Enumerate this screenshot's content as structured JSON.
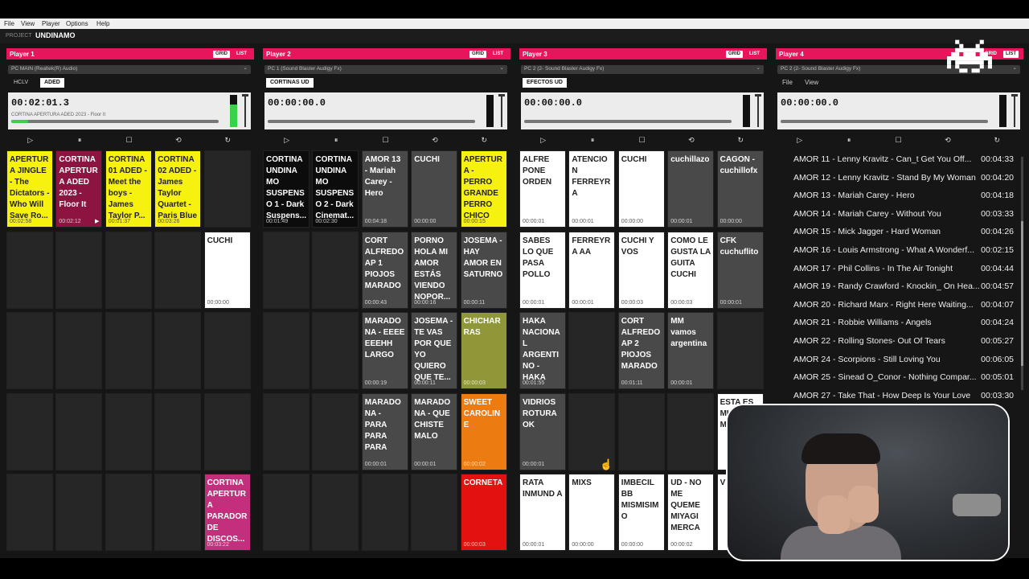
{
  "menu": {
    "file": "File",
    "view": "View",
    "player": "Player",
    "options": "Options",
    "help": "Help"
  },
  "project": {
    "label": "PROJECT",
    "name": "UNDINAMO"
  },
  "colors": {
    "accent": "#e6155c",
    "meter": "#38d14a"
  },
  "players": [
    {
      "name": "Player 1",
      "grid": "GRID",
      "list": "LIST",
      "device": "PC MAIN (Realtek(R) Audio)",
      "tabs": [
        "HCLV",
        "ADED"
      ],
      "active_tab": "ADED",
      "time": "00:02:01.3",
      "track": "CORTINA APERTURA ADED 2023 - Floor It",
      "progress": 0.08,
      "level": 0.7
    },
    {
      "name": "Player 2",
      "grid": "GRID",
      "list": "LIST",
      "device": "PC 1 (Sound Blaster Audigy Fx)",
      "tabs": [
        "CORTINAS UD"
      ],
      "active_tab": "CORTINAS UD",
      "time": "00:00:00.0",
      "track": "",
      "progress": 0,
      "level": 0
    },
    {
      "name": "Player 3",
      "grid": "GRID",
      "list": "LIST",
      "device": "PC 2 (2- Sound Blaster Audigy Fx)",
      "tabs": [
        "EFECTOS UD"
      ],
      "active_tab": "EFECTOS UD",
      "time": "00:00:00.0",
      "track": "",
      "progress": 0,
      "level": 0
    },
    {
      "name": "Player 4",
      "grid": "GRID",
      "list": "LIST",
      "device": "PC 2 (2- Sound Blaster Audigy Fx)",
      "tabs": [],
      "menu": [
        "File",
        "View"
      ],
      "time": "00:00:00.0",
      "track": "",
      "progress": 0,
      "level": 0
    }
  ],
  "controls": {
    "play": "play-icon",
    "pause": "pause-icon",
    "stop": "stop-icon",
    "loop": "loop-icon",
    "repeat": "repeat-icon"
  },
  "p1_cells": [
    {
      "title": "APERTUR A JINGLE - The Dictators - Who Will Save Ro...",
      "dur": "00:02:58",
      "color": "yellow"
    },
    {
      "title": "CORTINA APERTUR A ADED 2023 - Floor It",
      "dur": "00:02:12",
      "color": "maroon",
      "playing": true
    },
    {
      "title": "CORTINA 01 ADED - Meet the boys - James Taylor P...",
      "dur": "00:01:37",
      "color": "yellow"
    },
    {
      "title": "CORTINA 02 ADED - James Taylor Quartet - Paris Blue",
      "dur": "00:03:26",
      "color": "yellow"
    },
    {
      "title": "",
      "dur": "",
      "color": "empty"
    },
    {
      "title": "",
      "dur": "",
      "color": "empty"
    },
    {
      "title": "",
      "dur": "",
      "color": "empty"
    },
    {
      "title": "",
      "dur": "",
      "color": "empty"
    },
    {
      "title": "",
      "dur": "",
      "color": "empty"
    },
    {
      "title": "CUCHI",
      "dur": "00:00:00",
      "color": "white"
    },
    {
      "title": "",
      "dur": "",
      "color": "empty"
    },
    {
      "title": "",
      "dur": "",
      "color": "empty"
    },
    {
      "title": "",
      "dur": "",
      "color": "empty"
    },
    {
      "title": "",
      "dur": "",
      "color": "empty"
    },
    {
      "title": "",
      "dur": "",
      "color": "empty"
    },
    {
      "title": "",
      "dur": "",
      "color": "empty"
    },
    {
      "title": "",
      "dur": "",
      "color": "empty"
    },
    {
      "title": "",
      "dur": "",
      "color": "empty"
    },
    {
      "title": "",
      "dur": "",
      "color": "empty"
    },
    {
      "title": "",
      "dur": "",
      "color": "empty"
    },
    {
      "title": "",
      "dur": "",
      "color": "empty"
    },
    {
      "title": "",
      "dur": "",
      "color": "empty"
    },
    {
      "title": "",
      "dur": "",
      "color": "empty"
    },
    {
      "title": "",
      "dur": "",
      "color": "empty"
    },
    {
      "title": "CORTINA APERTUR A PARADOR DE DISCOS...",
      "dur": "00:03:22",
      "color": "pink"
    }
  ],
  "p2_cells": [
    {
      "title": "CORTINA UNDINA MO SUSPENS O 1 - Dark Suspens...",
      "dur": "00:01:49",
      "color": "black"
    },
    {
      "title": "CORTINA UNDINA MO SUSPENS O 2 - Dark Cinemat...",
      "dur": "00:02:30",
      "color": "black"
    },
    {
      "title": "AMOR 13 - Mariah Carey - Hero",
      "dur": "00:04:18",
      "color": "dk"
    },
    {
      "title": "CUCHI",
      "dur": "00:00:00",
      "color": "dk"
    },
    {
      "title": "APERTUR A - PERRO GRANDE PERRO CHICO",
      "dur": "00:00:15",
      "color": "yellow"
    },
    {
      "title": "",
      "dur": "",
      "color": "empty"
    },
    {
      "title": "",
      "dur": "",
      "color": "empty"
    },
    {
      "title": "CORT ALFREDO AP 1 PIOJOS MARADO",
      "dur": "00:00:43",
      "color": "dk"
    },
    {
      "title": "PORNO HOLA MI AMOR ESTÁS VIENDO NOPOR...",
      "dur": "00:00:16",
      "color": "dk"
    },
    {
      "title": "JOSEMA - HAY AMOR EN SATURNO",
      "dur": "00:00:11",
      "color": "dk"
    },
    {
      "title": "",
      "dur": "",
      "color": "empty"
    },
    {
      "title": "",
      "dur": "",
      "color": "empty"
    },
    {
      "title": "MARADO NA - EEEE EEEHH LARGO",
      "dur": "00:00:19",
      "color": "dk"
    },
    {
      "title": "JOSEMA - TE VAS POR QUE YO QUIERO QUE TE...",
      "dur": "00:00:11",
      "color": "dk"
    },
    {
      "title": "CHICHAR RAS",
      "dur": "00:00:03",
      "color": "olive"
    },
    {
      "title": "",
      "dur": "",
      "color": "empty"
    },
    {
      "title": "",
      "dur": "",
      "color": "empty"
    },
    {
      "title": "MARADO NA - PARA PARA PARA",
      "dur": "00:00:01",
      "color": "dk"
    },
    {
      "title": "MARADO NA - QUE CHISTE MALO",
      "dur": "00:00:01",
      "color": "dk"
    },
    {
      "title": "SWEET CAROLINE",
      "dur": "00:00:02",
      "color": "orange"
    },
    {
      "title": "",
      "dur": "",
      "color": "empty"
    },
    {
      "title": "",
      "dur": "",
      "color": "empty"
    },
    {
      "title": "",
      "dur": "",
      "color": "empty"
    },
    {
      "title": "",
      "dur": "",
      "color": "empty"
    },
    {
      "title": "CORNETA",
      "dur": "00:00:03",
      "color": "red"
    }
  ],
  "p3_cells": [
    {
      "title": "ALFRE PONE ORDEN",
      "dur": "00:00:01",
      "color": "white"
    },
    {
      "title": "ATENCIO N FERREYRA",
      "dur": "00:00:01",
      "color": "white"
    },
    {
      "title": "CUCHI",
      "dur": "00:00:00",
      "color": "white"
    },
    {
      "title": "cuchillazo",
      "dur": "00:00:01",
      "color": "dk"
    },
    {
      "title": "CAGON - cuchillofx",
      "dur": "00:00:00",
      "color": "dk"
    },
    {
      "title": "SABES LO QUE PASA POLLO",
      "dur": "00:00:01",
      "color": "white"
    },
    {
      "title": "FERREYRA AA",
      "dur": "00:00:01",
      "color": "white"
    },
    {
      "title": "CUCHI Y VOS",
      "dur": "00:00:03",
      "color": "white"
    },
    {
      "title": "COMO LE GUSTA LA GUITA CUCHI",
      "dur": "00:00:03",
      "color": "white"
    },
    {
      "title": "CFK cuchuflito",
      "dur": "00:00:01",
      "color": "dk"
    },
    {
      "title": "HAKA NACIONA L ARGENTI NO - HAKA",
      "dur": "00:01:55",
      "color": "dk"
    },
    {
      "title": "",
      "dur": "",
      "color": "empty"
    },
    {
      "title": "CORT ALFREDO AP 2 PIOJOS MARADO",
      "dur": "00:01:11",
      "color": "dk"
    },
    {
      "title": "MM vamos argentina",
      "dur": "00:00:01",
      "color": "dk"
    },
    {
      "title": "",
      "dur": "",
      "color": "empty"
    },
    {
      "title": "VIDRIOS ROTURA OK",
      "dur": "00:00:01",
      "color": "dk"
    },
    {
      "title": "",
      "dur": "",
      "color": "empty"
    },
    {
      "title": "",
      "dur": "",
      "color": "empty"
    },
    {
      "title": "",
      "dur": "",
      "color": "empty"
    },
    {
      "title": "ESTA ES MI VI UN M",
      "dur": "",
      "color": "white"
    },
    {
      "title": "RATA INMUND A",
      "dur": "00:00:01",
      "color": "white"
    },
    {
      "title": "MIXS",
      "dur": "00:00:00",
      "color": "white"
    },
    {
      "title": "IMBECIL BB MISMISIM O",
      "dur": "00:00:00",
      "color": "white"
    },
    {
      "title": "UD - NO ME QUEME MIYAGI MERCA",
      "dur": "00:00:02",
      "color": "white"
    },
    {
      "title": "V",
      "dur": "",
      "color": "white"
    }
  ],
  "p4_list": [
    {
      "name": "AMOR 11 - Lenny Kravitz - Can_t Get You Off...",
      "time": "00:04:33"
    },
    {
      "name": "AMOR 12 - Lenny Kravitz - Stand By My Woman",
      "time": "00:04:20"
    },
    {
      "name": "AMOR 13 - Mariah Carey - Hero",
      "time": "00:04:18"
    },
    {
      "name": "AMOR 14 - Mariah Carey - Without You",
      "time": "00:03:33"
    },
    {
      "name": "AMOR 15 - Mick Jagger - Hard Woman",
      "time": "00:04:26"
    },
    {
      "name": "AMOR 16 - Louis Armstrong - What A Wonderf...",
      "time": "00:02:15"
    },
    {
      "name": "AMOR 17 - Phil Collins - In The Air Tonight",
      "time": "00:04:44"
    },
    {
      "name": "AMOR 19 - Randy Crawford - Knockin_ On Hea...",
      "time": "00:04:57"
    },
    {
      "name": "AMOR 20 - Richard Marx - Right Here Waiting...",
      "time": "00:04:07"
    },
    {
      "name": "AMOR 21 - Robbie Williams - Angels",
      "time": "00:04:24"
    },
    {
      "name": "AMOR 22 - Rolling Stones- Out Of Tears",
      "time": "00:05:27"
    },
    {
      "name": "AMOR 24 - Scorpions - Still Loving You",
      "time": "00:06:05"
    },
    {
      "name": "AMOR 25 - Sinead O_Conor - Nothing Compar...",
      "time": "00:05:01"
    },
    {
      "name": "AMOR 27 - Take That - How Deep Is Your Love",
      "time": "00:03:30"
    }
  ]
}
